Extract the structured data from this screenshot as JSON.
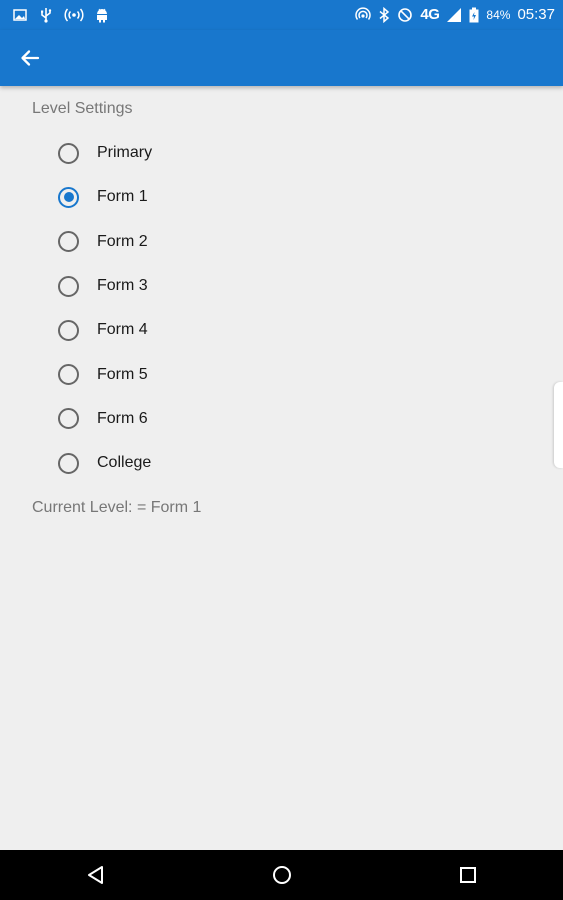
{
  "status_bar": {
    "battery_percent": "84%",
    "network": "4G",
    "time": "05:37",
    "left_icons": [
      "image-icon",
      "usb-icon",
      "hotspot-icon",
      "android-icon"
    ],
    "right_icons": [
      "cast-icon",
      "bluetooth-icon",
      "do-not-disturb-icon",
      "signal-icon",
      "battery-icon"
    ]
  },
  "app_bar": {
    "back_icon": "arrow-back-icon",
    "color": "#1877cd"
  },
  "settings": {
    "section_title": "Level Settings",
    "options": [
      {
        "label": "Primary",
        "checked": false
      },
      {
        "label": "Form 1",
        "checked": true
      },
      {
        "label": "Form 2",
        "checked": false
      },
      {
        "label": "Form 3",
        "checked": false
      },
      {
        "label": "Form 4",
        "checked": false
      },
      {
        "label": "Form 5",
        "checked": false
      },
      {
        "label": "Form 6",
        "checked": false
      },
      {
        "label": "College",
        "checked": false
      }
    ],
    "current_level": "Current Level: = Form 1"
  },
  "nav_bar": {
    "buttons": [
      "back-triangle-icon",
      "home-circle-icon",
      "recents-square-icon"
    ]
  }
}
